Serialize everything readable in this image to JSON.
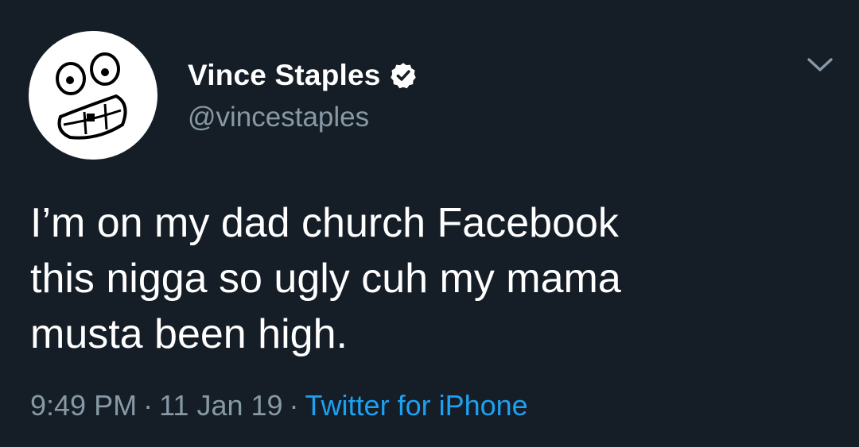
{
  "author": {
    "display_name": "Vince Staples",
    "handle": "@vincestaples",
    "verified": true
  },
  "tweet": {
    "lines": [
      "I’m on my dad church Facebook",
      "this nigga so ugly cuh my mama",
      "musta been high."
    ]
  },
  "meta": {
    "time": "9:49 PM",
    "separator": "·",
    "date": "11 Jan 19",
    "source": "Twitter for iPhone"
  },
  "icons": {
    "verified": "verified-badge-icon",
    "menu": "chevron-down-icon"
  },
  "colors": {
    "background": "#151d27",
    "text": "#ffffff",
    "secondary": "#8899a6",
    "accent": "#1da1f2"
  }
}
